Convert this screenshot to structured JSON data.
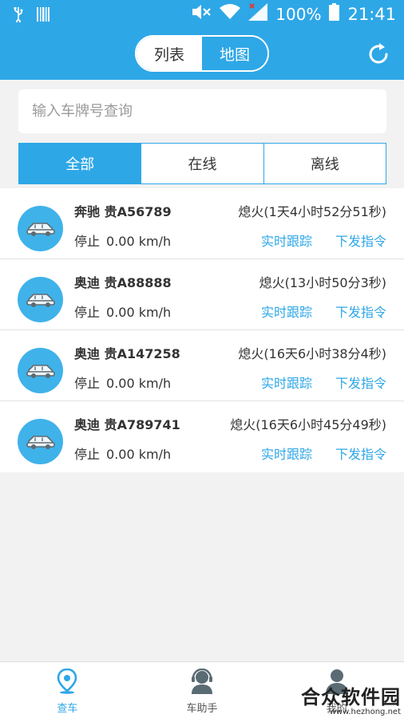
{
  "status_bar": {
    "battery_percent": "100%",
    "time": "21:41",
    "icons": [
      "usb-icon",
      "barcode-icon",
      "mute-icon",
      "wifi-icon",
      "signal-icon",
      "battery-icon"
    ]
  },
  "header": {
    "segments": [
      {
        "label": "列表",
        "selected": true
      },
      {
        "label": "地图",
        "selected": false
      }
    ],
    "refresh_icon": "refresh-icon"
  },
  "search": {
    "placeholder": "输入车牌号查询",
    "value": ""
  },
  "filter_tabs": [
    {
      "label": "全部",
      "active": true
    },
    {
      "label": "在线",
      "active": false
    },
    {
      "label": "离线",
      "active": false
    }
  ],
  "vehicles": [
    {
      "plate": "奔驰 贵A56789",
      "status": "熄火(1天4小时52分51秒)",
      "state": "停止",
      "speed": "0.00 km/h",
      "track_label": "实时跟踪",
      "command_label": "下发指令"
    },
    {
      "plate": "奥迪 贵A88888",
      "status": "熄火(13小时50分3秒)",
      "state": "停止",
      "speed": "0.00 km/h",
      "track_label": "实时跟踪",
      "command_label": "下发指令"
    },
    {
      "plate": "奥迪 贵A147258",
      "status": "熄火(16天6小时38分4秒)",
      "state": "停止",
      "speed": "0.00 km/h",
      "track_label": "实时跟踪",
      "command_label": "下发指令"
    },
    {
      "plate": "奥迪 贵A789741",
      "status": "熄火(16天6小时45分49秒)",
      "state": "停止",
      "speed": "0.00 km/h",
      "track_label": "实时跟踪",
      "command_label": "下发指令"
    }
  ],
  "bottom_nav": [
    {
      "label": "查车",
      "icon": "map-pin-icon",
      "active": true
    },
    {
      "label": "车助手",
      "icon": "assistant-icon",
      "active": false
    },
    {
      "label": "我的",
      "icon": "user-icon",
      "active": false
    }
  ],
  "watermark": {
    "text": "合众软件园",
    "url_text": "www.hezhong.net"
  },
  "colors": {
    "accent": "#2ea7e7",
    "background": "#f2f2f2",
    "text": "#333333"
  }
}
